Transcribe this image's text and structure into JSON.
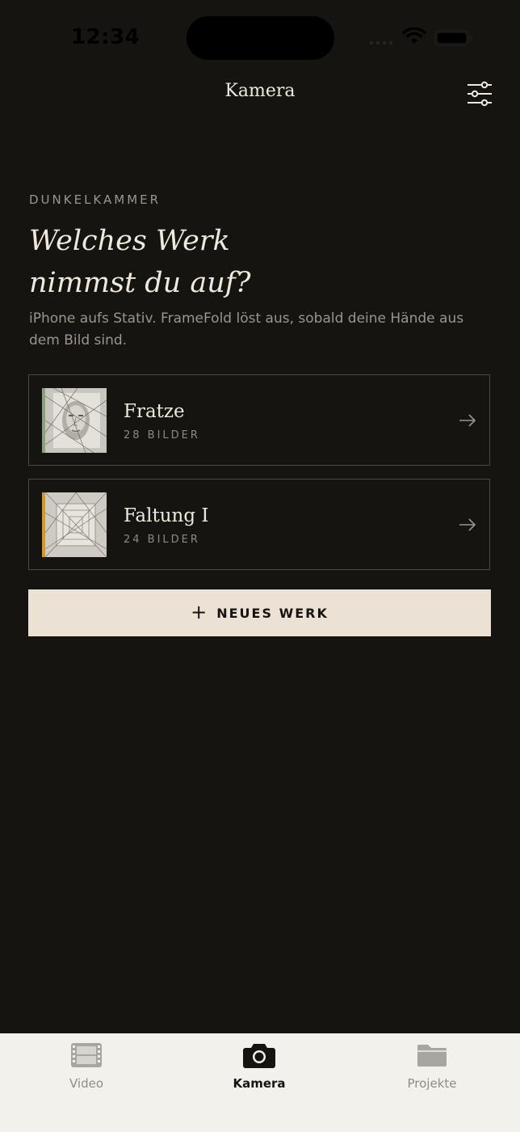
{
  "status_bar": {
    "time": "12:34"
  },
  "nav": {
    "title": "Kamera",
    "settings_icon": "sliders-icon"
  },
  "intro": {
    "eyebrow": "DUNKELKAMMER",
    "headline": "Welches Werk\nnimmst du auf?",
    "subtitle": "iPhone aufs Stativ. FrameFold löst aus, sobald deine Hände aus dem Bild sind."
  },
  "works": [
    {
      "name": "Fratze",
      "count": "28 BILDER",
      "accent_color": "#8aa07f"
    },
    {
      "name": "Faltung I",
      "count": "24 BILDER",
      "accent_color": "#d19a2c"
    }
  ],
  "new_work": {
    "label": "NEUES WERK",
    "icon": "plus-icon"
  },
  "tabs": [
    {
      "label": "Video",
      "icon": "film-icon",
      "active": false
    },
    {
      "label": "Kamera",
      "icon": "camera-icon",
      "active": true
    },
    {
      "label": "Projekte",
      "icon": "folder-icon",
      "active": false
    }
  ],
  "colors": {
    "background": "#161411",
    "text": "#efe8dc",
    "muted": "#9b958b",
    "button": "#ebe2d5",
    "tabbar": "#f3f1ec"
  }
}
